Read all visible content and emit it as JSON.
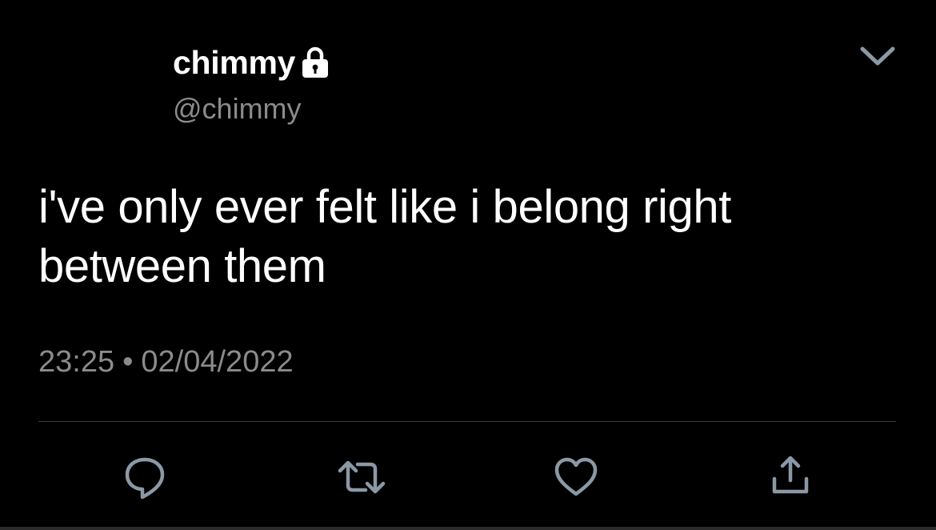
{
  "tweet": {
    "display_name": "chimmy",
    "handle": "@chimmy",
    "protected_icon": "lock-icon",
    "text_line1": "i've only ever felt like i belong right",
    "text_line2": "between them",
    "time": "23:25",
    "separator": "•",
    "date": "02/04/2022"
  },
  "menu": {
    "icon": "chevron-down-icon"
  },
  "actions": [
    {
      "name": "reply",
      "icon": "reply-icon"
    },
    {
      "name": "retweet",
      "icon": "retweet-icon"
    },
    {
      "name": "like",
      "icon": "heart-icon"
    },
    {
      "name": "share",
      "icon": "share-icon"
    }
  ],
  "colors": {
    "background": "#000000",
    "text": "#ffffff",
    "secondary": "#8b8b8b",
    "icon": "#8b98a5",
    "divider": "#3a3a3a"
  }
}
